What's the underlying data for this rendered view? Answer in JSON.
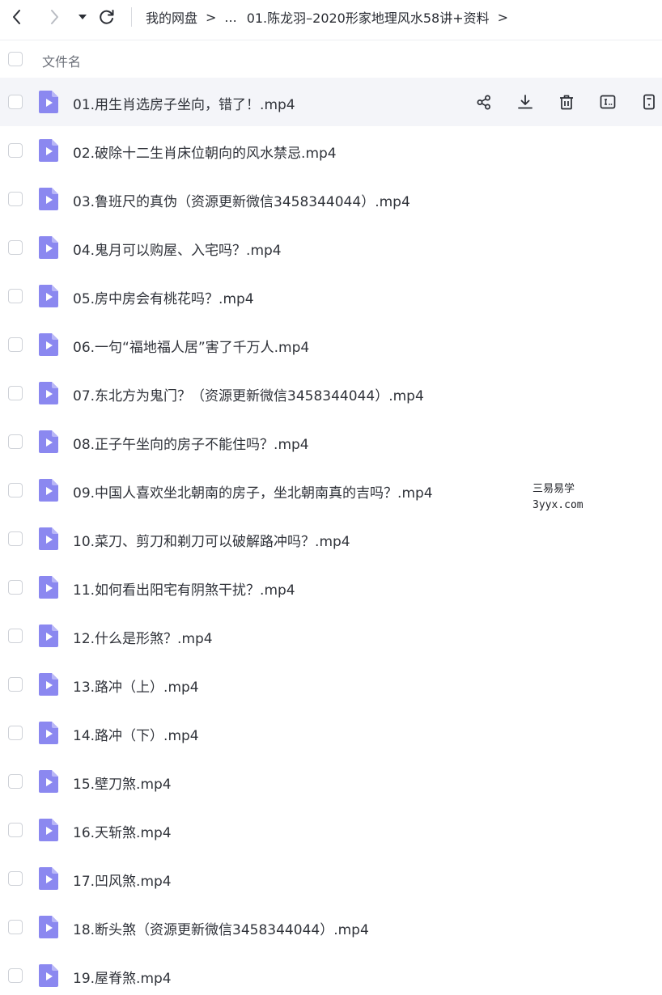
{
  "toolbar": {
    "back_icon": "chevron-left-icon",
    "forward_icon": "chevron-right-icon",
    "history_icon": "caret-down-icon",
    "refresh_icon": "refresh-icon"
  },
  "breadcrumb": {
    "root": "我的网盘",
    "ellipsis": "...",
    "current": "01.陈龙羽–2020形家地理风水58讲+资料",
    "separator": ">"
  },
  "list_header": {
    "column_name": "文件名"
  },
  "row_actions": {
    "icons": [
      "share-icon",
      "download-icon",
      "delete-icon",
      "rename-icon",
      "more-icon"
    ]
  },
  "files": [
    {
      "name": "01.用生肖选房子坐向，错了！.mp4",
      "type": "video"
    },
    {
      "name": "02.破除十二生肖床位朝向的风水禁忌.mp4",
      "type": "video"
    },
    {
      "name": "03.鲁班尺的真伪（资源更新微信3458344044）.mp4",
      "type": "video"
    },
    {
      "name": "04.鬼月可以购屋、入宅吗？.mp4",
      "type": "video"
    },
    {
      "name": "05.房中房会有桃花吗？.mp4",
      "type": "video"
    },
    {
      "name": "06.一句“福地福人居”害了千万人.mp4",
      "type": "video"
    },
    {
      "name": "07.东北方为鬼门？（资源更新微信3458344044）.mp4",
      "type": "video"
    },
    {
      "name": "08.正子午坐向的房子不能住吗？.mp4",
      "type": "video"
    },
    {
      "name": "09.中国人喜欢坐北朝南的房子，坐北朝南真的吉吗？.mp4",
      "type": "video"
    },
    {
      "name": "10.菜刀、剪刀和剃刀可以破解路冲吗？.mp4",
      "type": "video"
    },
    {
      "name": "11.如何看出阳宅有阴煞干扰？.mp4",
      "type": "video"
    },
    {
      "name": "12.什么是形煞？.mp4",
      "type": "video"
    },
    {
      "name": "13.路冲（上）.mp4",
      "type": "video"
    },
    {
      "name": "14.路冲（下）.mp4",
      "type": "video"
    },
    {
      "name": "15.壁刀煞.mp4",
      "type": "video"
    },
    {
      "name": "16.天斩煞.mp4",
      "type": "video"
    },
    {
      "name": "17.凹风煞.mp4",
      "type": "video"
    },
    {
      "name": "18.断头煞（资源更新微信3458344044）.mp4",
      "type": "video"
    },
    {
      "name": "19.屋脊煞.mp4",
      "type": "video"
    }
  ],
  "watermark": {
    "line1": "三易易学",
    "line2": "3yyx.com"
  },
  "colors": {
    "video_icon": "#8b88f0",
    "hover_row": "#f4f5f9",
    "text": "#2f3239",
    "muted": "#6b6f78"
  }
}
